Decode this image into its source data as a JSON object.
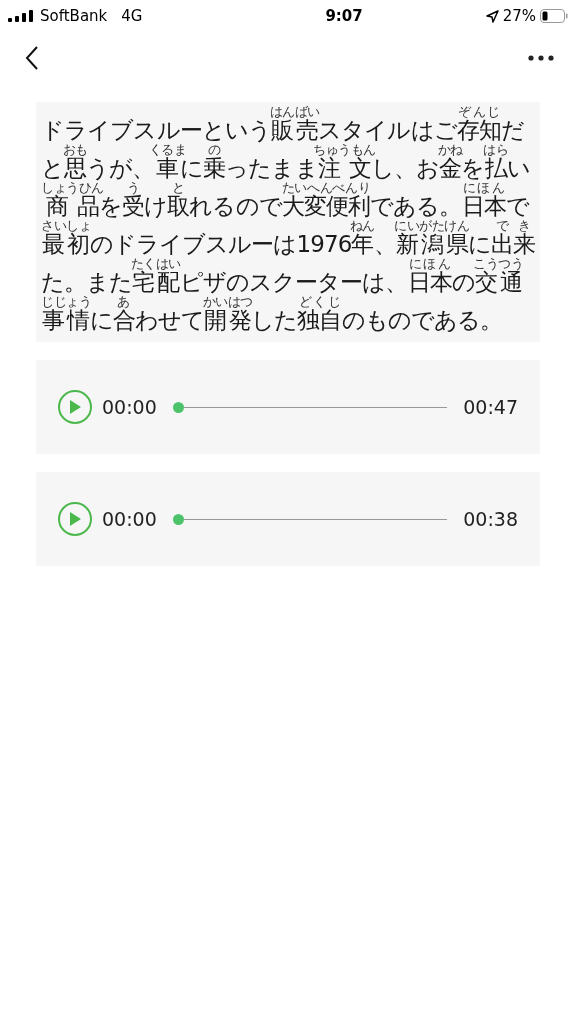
{
  "status_bar": {
    "carrier": "SoftBank",
    "network": "4G",
    "time": "9:07",
    "battery": "27%"
  },
  "passage": {
    "lines": [
      [
        {
          "t": "ドライブスルーという"
        },
        {
          "t": "販売",
          "r": "はんばい"
        },
        {
          "t": "スタイルはご"
        },
        {
          "t": "存知",
          "r": "ぞんじ"
        },
        {
          "t": "だ"
        }
      ],
      [
        {
          "t": "と"
        },
        {
          "t": "思",
          "r": "おも"
        },
        {
          "t": "うが、"
        },
        {
          "t": "車",
          "r": "くるま"
        },
        {
          "t": "に"
        },
        {
          "t": "乗",
          "r": "の"
        },
        {
          "t": "ったまま"
        },
        {
          "t": "注文",
          "r": "ちゅうもん"
        },
        {
          "t": "し、お"
        },
        {
          "t": "金",
          "r": "かね"
        },
        {
          "t": "を"
        },
        {
          "t": "払",
          "r": "はら"
        },
        {
          "t": "い"
        }
      ],
      [
        {
          "t": "商品",
          "r": "しょうひん"
        },
        {
          "t": "を"
        },
        {
          "t": "受",
          "r": "う"
        },
        {
          "t": "け"
        },
        {
          "t": "取",
          "r": "と"
        },
        {
          "t": "れるので"
        },
        {
          "t": "大変便利",
          "r": "たいへんべんり"
        },
        {
          "t": "である。"
        },
        {
          "t": "日本",
          "r": "にほん"
        },
        {
          "t": "で"
        }
      ],
      [
        {
          "t": "最初",
          "r": "さいしょ"
        },
        {
          "t": "のドライブスルーは1976"
        },
        {
          "t": "年",
          "r": "ねん"
        },
        {
          "t": "、"
        },
        {
          "t": "新潟県",
          "r": "にいがたけん"
        },
        {
          "t": "に"
        },
        {
          "t": "出来",
          "r": "でき"
        }
      ],
      [
        {
          "t": "た。また"
        },
        {
          "t": "宅配",
          "r": "たくはい"
        },
        {
          "t": "ピザのスクーターは、"
        },
        {
          "t": "日本",
          "r": "にほん"
        },
        {
          "t": "の"
        },
        {
          "t": "交通",
          "r": "こうつう"
        }
      ],
      [
        {
          "t": "事情",
          "r": "じじょう"
        },
        {
          "t": "に"
        },
        {
          "t": "合",
          "r": "あ"
        },
        {
          "t": "わせて"
        },
        {
          "t": "開発",
          "r": "かいはつ"
        },
        {
          "t": "した"
        },
        {
          "t": "独自",
          "r": "どくじ"
        },
        {
          "t": "のものである。"
        }
      ]
    ]
  },
  "players": [
    {
      "current": "00:00",
      "duration": "00:47",
      "level": 0
    },
    {
      "current": "00:00",
      "duration": "00:38",
      "level": 0
    }
  ]
}
